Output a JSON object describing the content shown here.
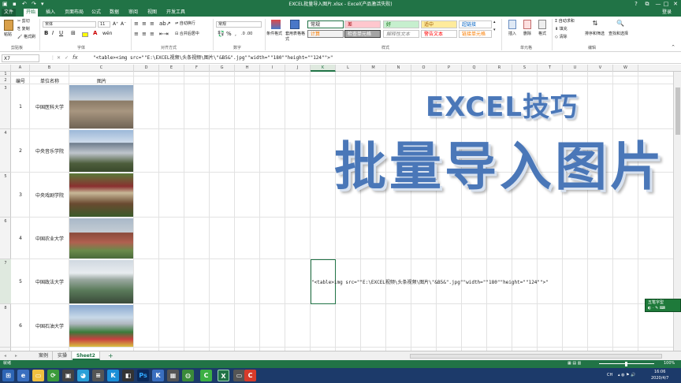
{
  "titlebar": {
    "title": "EXCEL批量导入图片.xlsx - Excel(产品激活失败)",
    "help": "?",
    "restore": "⧉",
    "minimize": "—",
    "maximize": "□",
    "close": "✕"
  },
  "menu": {
    "tabs": [
      "文件",
      "开始",
      "插入",
      "页面布局",
      "公式",
      "数据",
      "审阅",
      "视图",
      "开发工具"
    ],
    "active_index": 1,
    "login": "登录"
  },
  "ribbon": {
    "clipboard": {
      "paste": "粘贴",
      "cut": "剪切",
      "copy": "复制",
      "format_painter": "格式刷",
      "label": "剪贴板"
    },
    "font": {
      "name": "宋体",
      "size": "11",
      "bold": "B",
      "italic": "I",
      "underline": "U",
      "label": "字体"
    },
    "alignment": {
      "wrap": "自动换行",
      "merge": "合并后居中",
      "label": "对齐方式"
    },
    "number": {
      "format": "常规",
      "label": "数字"
    },
    "styles": {
      "conditional": "条件格式",
      "table": "套用表格格式",
      "cells": [
        {
          "text": "常规",
          "bg": "#ffffff",
          "fg": "#222222",
          "border": "#217346"
        },
        {
          "text": "差",
          "bg": "#ffc7ce",
          "fg": "#9c0006",
          "border": "#c8c8c8"
        },
        {
          "text": "好",
          "bg": "#c6efce",
          "fg": "#006100",
          "border": "#c8c8c8"
        },
        {
          "text": "适中",
          "bg": "#ffeb9c",
          "fg": "#9c5700",
          "border": "#c8c8c8"
        },
        {
          "text": "超链接",
          "bg": "#ffffff",
          "fg": "#0563c1",
          "border": "#c8c8c8"
        },
        {
          "text": "计算",
          "bg": "#f2f2f2",
          "fg": "#fa7d00",
          "border": "#7f7f7f"
        },
        {
          "text": "检查单元格",
          "bg": "#a5a5a5",
          "fg": "#ffffff",
          "border": "#3f3f3f"
        },
        {
          "text": "解释性文本",
          "bg": "#ffffff",
          "fg": "#7f7f7f",
          "border": "#c8c8c8"
        },
        {
          "text": "警告文本",
          "bg": "#ffffff",
          "fg": "#ff0000",
          "border": "#c8c8c8"
        },
        {
          "text": "链接单元格",
          "bg": "#ffffff",
          "fg": "#fa7d00",
          "border": "#c8c8c8"
        }
      ],
      "label": "样式"
    },
    "cells": {
      "insert": "插入",
      "delete": "删除",
      "format": "格式",
      "label": "单元格"
    },
    "editing": {
      "autosum": "自动求和",
      "fill": "填充",
      "clear": "清除",
      "sort": "排序和筛选",
      "find": "查找和选择",
      "label": "编辑"
    }
  },
  "formula_bar": {
    "name_box": "X7",
    "fx": "fx",
    "formula": "\"<table><img src=\"\"E:\\EXCEL视频\\头条视频\\图片\\\"&B5&\".jpg\"\"width=\"\"180\"\"height=\"\"124\"\">\""
  },
  "columns": [
    "A",
    "B",
    "C",
    "D",
    "E",
    "F",
    "G",
    "H",
    "I",
    "J",
    "K",
    "L",
    "M",
    "N",
    "O",
    "P",
    "Q",
    "R",
    "S",
    "T",
    "U",
    "V",
    "W"
  ],
  "selected_column": "K",
  "rows": [
    "1",
    "2",
    "3",
    "4",
    "5",
    "6",
    "7",
    "8"
  ],
  "headers": {
    "a": "编号",
    "b": "单位名称",
    "c": "图片"
  },
  "table": [
    {
      "id": "1",
      "name": "中国医科大学"
    },
    {
      "id": "2",
      "name": "中央音乐学院"
    },
    {
      "id": "3",
      "name": "中央戏剧学院"
    },
    {
      "id": "4",
      "name": "中国农业大学"
    },
    {
      "id": "5",
      "name": "中国政法大学"
    },
    {
      "id": "6",
      "name": "中国石油大学"
    }
  ],
  "overlay": {
    "line1": "EXCEL技巧",
    "line2": "批量导入图片"
  },
  "k7_text": "\"<table>img src=\"\"E:\\EXCEL视频\\头条视频\\图片\\\"&B5&\".jpg\"\"width=\"\"180\"\"height=\"\"124\"\">\"",
  "ime": {
    "label": "五笔字型"
  },
  "sheet_tabs": [
    "案例",
    "实操",
    "Sheet2"
  ],
  "active_sheet": 2,
  "add_sheet": "+",
  "status": {
    "ready": "就绪",
    "zoom": "100%"
  },
  "taskbar": {
    "time": "16:06",
    "date": "2020/4/7",
    "lang": "CH"
  }
}
